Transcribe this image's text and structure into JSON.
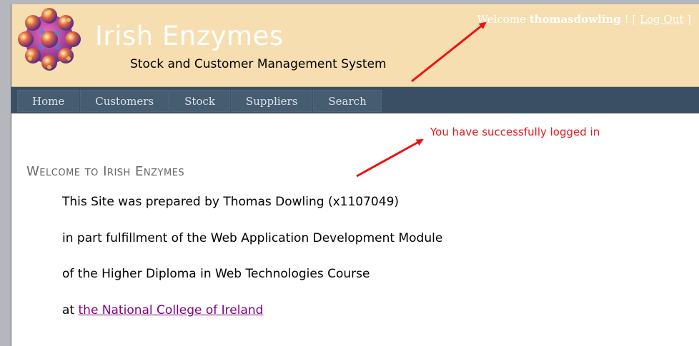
{
  "header": {
    "title": "Irish Enzymes",
    "subtitle": "Stock and Customer Management System",
    "login": {
      "welcome_prefix": "Welcome",
      "username": "thomasdowling",
      "separator": "! [",
      "logout_label": "Log Out",
      "close_bracket": "]"
    }
  },
  "nav": {
    "items": [
      {
        "label": "Home"
      },
      {
        "label": "Customers"
      },
      {
        "label": "Stock"
      },
      {
        "label": "Suppliers"
      },
      {
        "label": "Search"
      }
    ]
  },
  "main": {
    "flash_message": "You have successfully logged in",
    "heading": "Welcome to Irish Enzymes",
    "line1": "This Site was prepared by Thomas Dowling (x1107049)",
    "line2": "in part fulfillment of the Web Application Development Module",
    "line3": "of the Higher Diploma in Web Technologies Course",
    "line4_prefix": "at",
    "link_text": "the National College of Ireland"
  },
  "colors": {
    "header_bg": "#f6deb0",
    "nav_bg": "#3a4f63",
    "flash": "#e3181b",
    "link": "#800080",
    "arrow": "#ee1111"
  },
  "icons": {
    "logo": "molecule-logo-icon",
    "arrows": "annotation-arrow-icon"
  }
}
